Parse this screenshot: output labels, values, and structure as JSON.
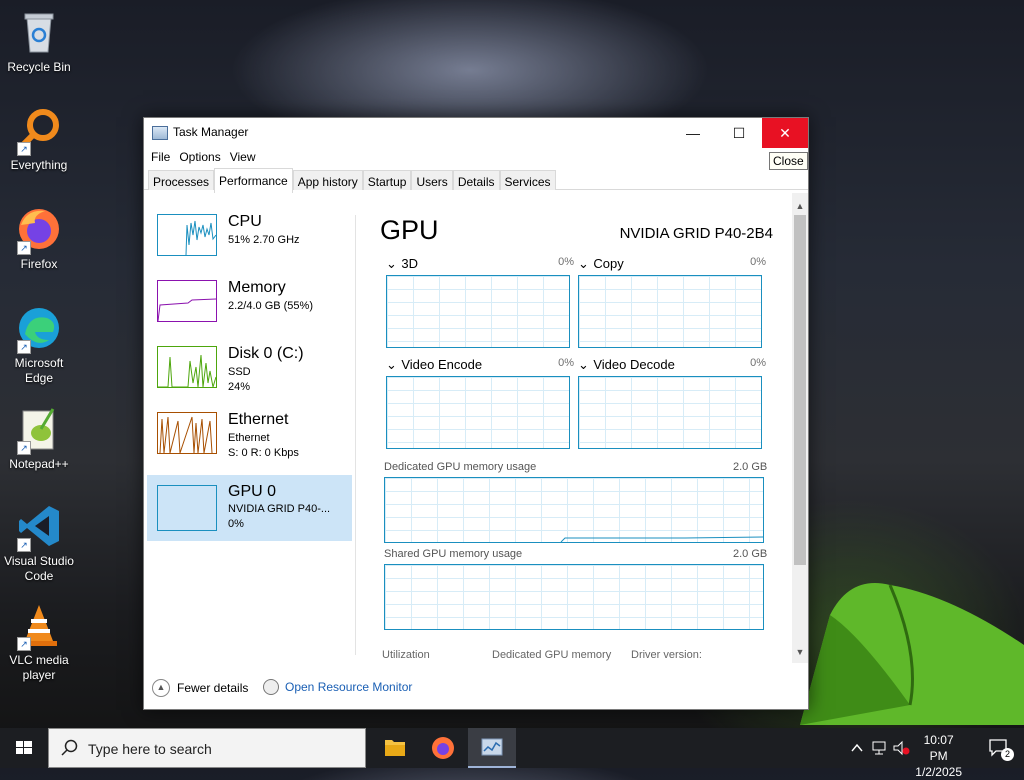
{
  "desktop": {
    "icons": [
      {
        "label": "Recycle Bin",
        "icon": "recycle-bin-icon"
      },
      {
        "label": "Everything",
        "icon": "everything-search-icon"
      },
      {
        "label": "Firefox",
        "icon": "firefox-icon"
      },
      {
        "label": "Microsoft Edge",
        "icon": "edge-icon"
      },
      {
        "label": "Notepad++",
        "icon": "notepadpp-icon"
      },
      {
        "label": "Visual Studio Code",
        "icon": "vscode-icon"
      },
      {
        "label": "VLC media player",
        "icon": "vlc-icon"
      }
    ]
  },
  "window": {
    "title": "Task Manager",
    "close_tooltip": "Close",
    "menu": [
      "File",
      "Options",
      "View"
    ],
    "tabs": [
      "Processes",
      "Performance",
      "App history",
      "Startup",
      "Users",
      "Details",
      "Services"
    ],
    "active_tab": "Performance",
    "sidebar": [
      {
        "name": "CPU",
        "line1": "51% 2.70 GHz",
        "line2": "",
        "color": "#1a8fbf"
      },
      {
        "name": "Memory",
        "line1": "2.2/4.0 GB (55%)",
        "line2": "",
        "color": "#8b12ae"
      },
      {
        "name": "Disk 0 (C:)",
        "line1": "SSD",
        "line2": "24%",
        "color": "#4da60c"
      },
      {
        "name": "Ethernet",
        "line1": "Ethernet",
        "line2": "S: 0 R: 0 Kbps",
        "color": "#a74f01"
      },
      {
        "name": "GPU 0",
        "line1": "NVIDIA GRID P40-...",
        "line2": "0%",
        "color": "#1a8fbf"
      }
    ],
    "gpu": {
      "title": "GPU",
      "model": "NVIDIA GRID P40-2B4",
      "engines": [
        {
          "label": "3D",
          "percent": "0%"
        },
        {
          "label": "Copy",
          "percent": "0%"
        },
        {
          "label": "Video Encode",
          "percent": "0%"
        },
        {
          "label": "Video Decode",
          "percent": "0%"
        }
      ],
      "dedicated_label": "Dedicated GPU memory usage",
      "dedicated_max": "2.0 GB",
      "shared_label": "Shared GPU memory usage",
      "shared_max": "2.0 GB",
      "footer": [
        "Utilization",
        "Dedicated GPU memory",
        "Driver version:"
      ]
    },
    "fewer_details": "Fewer details",
    "open_resource_monitor": "Open Resource Monitor"
  },
  "taskbar": {
    "search_placeholder": "Type here to search",
    "time": "10:07 PM",
    "date": "1/2/2025",
    "notification_count": "2"
  }
}
